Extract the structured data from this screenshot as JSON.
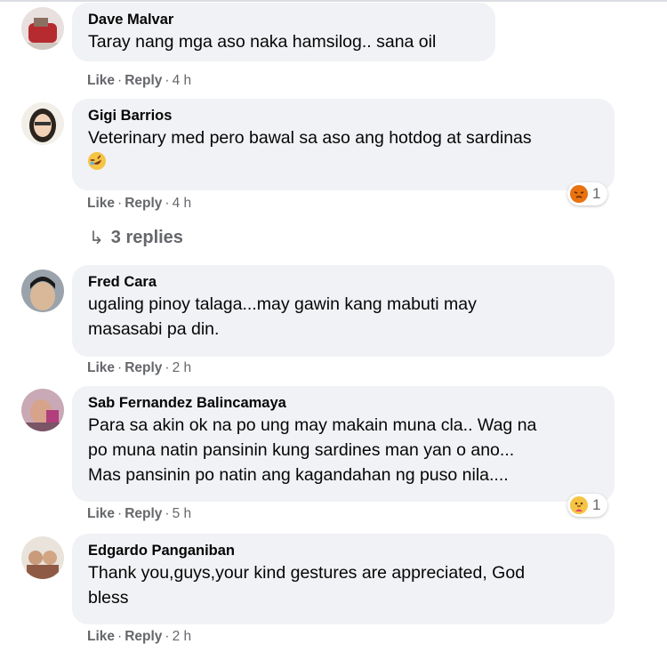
{
  "comments": [
    {
      "name": "Dave Malvar",
      "text": "Taray nang mga aso naka hamsilog.. sana oil",
      "like": "Like",
      "reply": "Reply",
      "time": "4 h"
    },
    {
      "name": "Gigi Barrios",
      "text": "Veterinary med pero bawal sa aso ang hotdog at sardinas",
      "emoji_inline": "rofl-emoji",
      "like": "Like",
      "reply": "Reply",
      "time": "4 h",
      "reaction": {
        "icon": "angry-reaction-icon",
        "count": "1"
      }
    },
    {
      "name": "Fred Cara",
      "text": "ugaling pinoy talaga...may gawin kang mabuti may\nmasasabi pa din.",
      "like": "Like",
      "reply": "Reply",
      "time": "2 h"
    },
    {
      "name": "Sab Fernandez Balincamaya",
      "text": "Para sa akin ok na po ung may makain muna cla.. Wag na\npo muna natin pansinin kung sardines man yan o ano...\nMas pansinin po natin ang kagandahan ng puso nila....",
      "like": "Like",
      "reply": "Reply",
      "time": "5 h",
      "reaction": {
        "icon": "care-reaction-icon",
        "count": "1"
      }
    },
    {
      "name": "Edgardo Panganiban",
      "text": "Thank you,guys,your kind gestures are appreciated, God\nbless",
      "like": "Like",
      "reply": "Reply",
      "time": "2 h"
    }
  ],
  "replies_link": "3 replies",
  "colors": {
    "bubble": "#f0f2f5",
    "meta": "#65676b",
    "text": "#050505"
  }
}
